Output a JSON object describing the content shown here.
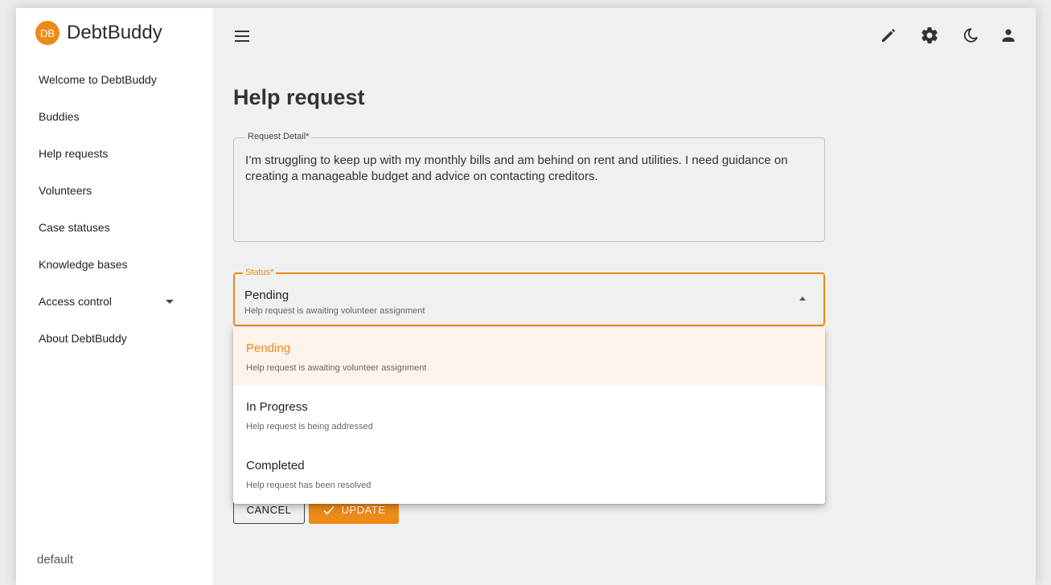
{
  "app": {
    "logo_initials": "DB",
    "name": "DebtBuddy"
  },
  "sidebar": {
    "items": [
      {
        "label": "Welcome to DebtBuddy"
      },
      {
        "label": "Buddies"
      },
      {
        "label": "Help requests"
      },
      {
        "label": "Volunteers"
      },
      {
        "label": "Case statuses"
      },
      {
        "label": "Knowledge bases"
      },
      {
        "label": "Access control",
        "has_dropdown": true
      },
      {
        "label": "About DebtBuddy"
      }
    ],
    "footer": "default"
  },
  "topbar": {
    "icons": [
      "menu-icon",
      "pencil-icon",
      "settings-icon",
      "dark-mode-icon",
      "account-icon"
    ]
  },
  "page": {
    "title": "Help request"
  },
  "form": {
    "request_detail": {
      "label": "Request Detail*",
      "value": "I’m struggling to keep up with my monthly bills and am behind on rent and utilities. I need guidance on creating a manageable budget and advice on contacting creditors."
    },
    "status": {
      "label": "Status*",
      "value": "Pending",
      "description": "Help request is awaiting volunteer assignment",
      "options": [
        {
          "label": "Pending",
          "description": "Help request is awaiting volunteer assignment",
          "selected": true
        },
        {
          "label": "In Progress",
          "description": "Help request is being addressed"
        },
        {
          "label": "Completed",
          "description": "Help request has been resolved"
        }
      ]
    },
    "buttons": {
      "cancel": "CANCEL",
      "update": "UPDATE"
    }
  },
  "colors": {
    "accent": "#ee8a17",
    "background": "#f0f0f0",
    "sidebar": "#ffffff"
  }
}
